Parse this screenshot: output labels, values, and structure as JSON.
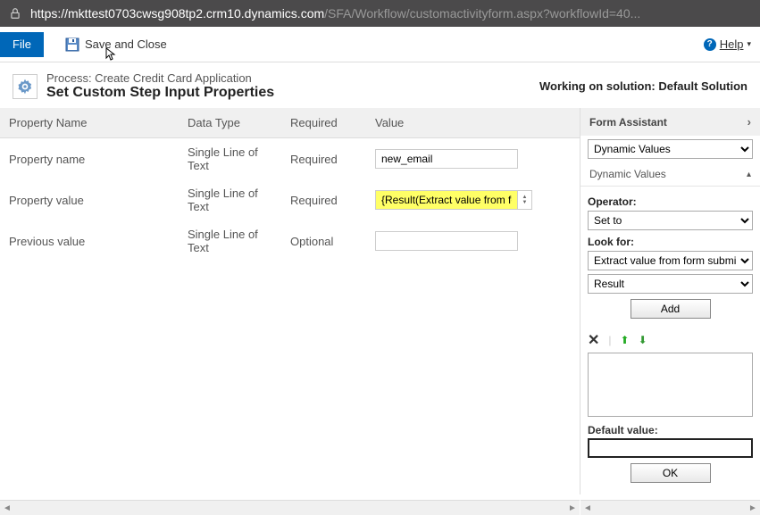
{
  "url": {
    "domain": "https://mkttest0703cwsg908tp2.crm10.dynamics.com",
    "path": "/SFA/Workflow/customactivityform.aspx?workflowId=40..."
  },
  "cmdbar": {
    "file": "File",
    "save_close": "Save and Close",
    "help": "Help"
  },
  "header": {
    "process_label": "Process: Create Credit Card Application",
    "title": "Set Custom Step Input Properties",
    "solution": "Working on solution: Default Solution"
  },
  "table": {
    "headers": [
      "Property Name",
      "Data Type",
      "Required",
      "Value"
    ],
    "rows": [
      {
        "name": "Property name",
        "type": "Single Line of Text",
        "req": "Required",
        "value": "new_email",
        "hl": false
      },
      {
        "name": "Property value",
        "type": "Single Line of Text",
        "req": "Required",
        "value": "{Result(Extract value from form",
        "hl": true,
        "spin": true
      },
      {
        "name": "Previous value",
        "type": "Single Line of Text",
        "req": "Optional",
        "value": "",
        "hl": false
      }
    ]
  },
  "assistant": {
    "title": "Form Assistant",
    "dynamic_values": "Dynamic Values",
    "dynamic_values_sub": "Dynamic Values",
    "operator_label": "Operator:",
    "operator_value": "Set to",
    "lookfor_label": "Look for:",
    "lookfor_entity": "Extract value from form submission",
    "lookfor_attr": "Result",
    "add": "Add",
    "default_label": "Default value:",
    "default_value": "",
    "ok": "OK"
  }
}
